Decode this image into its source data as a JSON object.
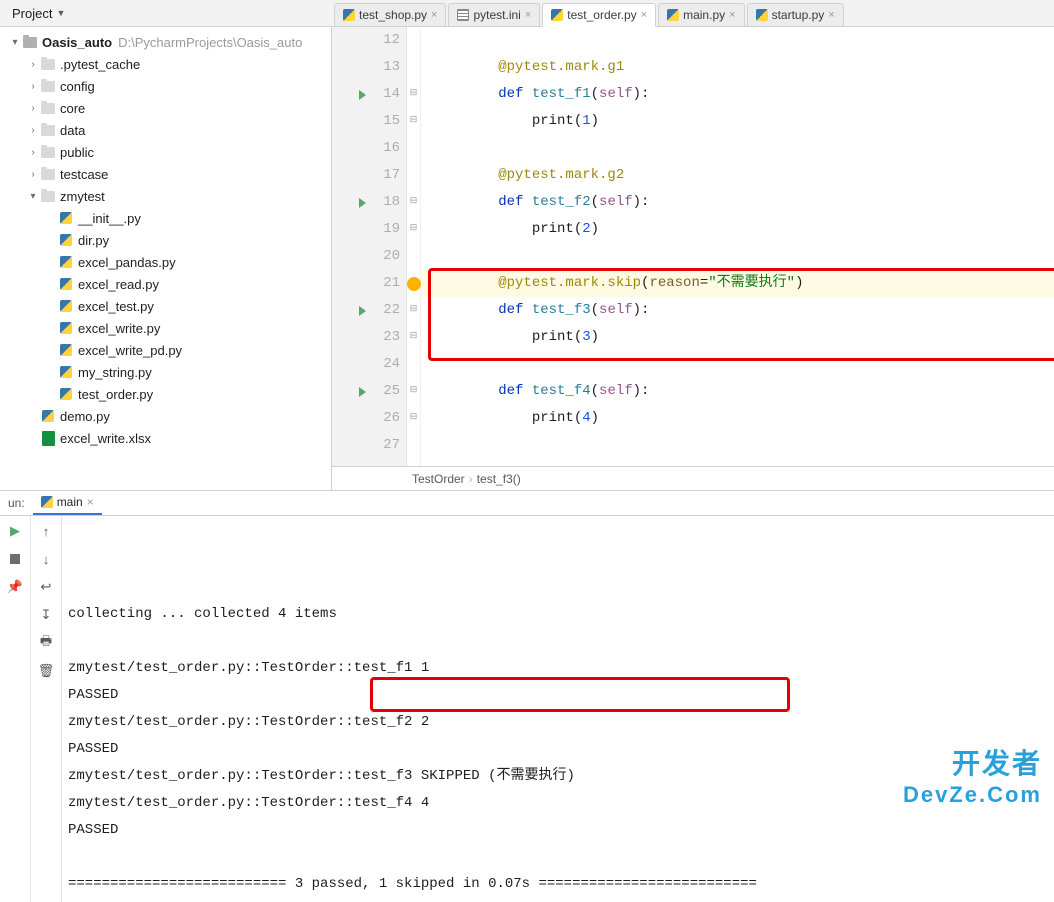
{
  "toolbar": {
    "project_label": "Project"
  },
  "tabs": [
    {
      "label": "test_shop.py",
      "icon": "py",
      "active": false
    },
    {
      "label": "pytest.ini",
      "icon": "cfg",
      "active": false
    },
    {
      "label": "test_order.py",
      "icon": "py",
      "active": true
    },
    {
      "label": "main.py",
      "icon": "py",
      "active": false
    },
    {
      "label": "startup.py",
      "icon": "py",
      "active": false
    }
  ],
  "tree": {
    "root": {
      "name": "Oasis_auto",
      "path": "D:\\PycharmProjects\\Oasis_auto"
    },
    "items": [
      {
        "name": ".pytest_cache",
        "icon": "folder",
        "depth": 1,
        "tw": ">"
      },
      {
        "name": "config",
        "icon": "folder",
        "depth": 1,
        "tw": ">"
      },
      {
        "name": "core",
        "icon": "folder",
        "depth": 1,
        "tw": ">"
      },
      {
        "name": "data",
        "icon": "folder",
        "depth": 1,
        "tw": ">"
      },
      {
        "name": "public",
        "icon": "folder",
        "depth": 1,
        "tw": ">"
      },
      {
        "name": "testcase",
        "icon": "folder",
        "depth": 1,
        "tw": ">"
      },
      {
        "name": "zmytest",
        "icon": "folder",
        "depth": 1,
        "tw": "v"
      },
      {
        "name": "__init__.py",
        "icon": "py",
        "depth": 2
      },
      {
        "name": "dir.py",
        "icon": "py",
        "depth": 2
      },
      {
        "name": "excel_pandas.py",
        "icon": "py",
        "depth": 2
      },
      {
        "name": "excel_read.py",
        "icon": "py",
        "depth": 2
      },
      {
        "name": "excel_test.py",
        "icon": "py",
        "depth": 2
      },
      {
        "name": "excel_write.py",
        "icon": "py",
        "depth": 2
      },
      {
        "name": "excel_write_pd.py",
        "icon": "py",
        "depth": 2
      },
      {
        "name": "my_string.py",
        "icon": "py",
        "depth": 2
      },
      {
        "name": "test_order.py",
        "icon": "py",
        "depth": 2
      },
      {
        "name": "demo.py",
        "icon": "py",
        "depth": 1
      },
      {
        "name": "excel_write.xlsx",
        "icon": "xlsx",
        "depth": 1
      }
    ]
  },
  "editor": {
    "lines": [
      {
        "n": 12,
        "parts": []
      },
      {
        "n": 13,
        "parts": [
          {
            "t": "@pytest.mark.g1",
            "c": "dec"
          }
        ]
      },
      {
        "n": 14,
        "run": true,
        "parts": [
          {
            "t": "def ",
            "c": "kw"
          },
          {
            "t": "test_f1",
            "c": "fn"
          },
          {
            "t": "("
          },
          {
            "t": "self",
            "c": "bself"
          },
          {
            "t": "):"
          }
        ]
      },
      {
        "n": 15,
        "parts": [
          {
            "t": "    print",
            "c": ""
          },
          {
            "t": "("
          },
          {
            "t": "1",
            "c": "num"
          },
          {
            "t": ")"
          }
        ]
      },
      {
        "n": 16,
        "parts": []
      },
      {
        "n": 17,
        "parts": [
          {
            "t": "@pytest.mark.g2",
            "c": "dec"
          }
        ]
      },
      {
        "n": 18,
        "run": true,
        "parts": [
          {
            "t": "def ",
            "c": "kw"
          },
          {
            "t": "test_f2",
            "c": "fn"
          },
          {
            "t": "("
          },
          {
            "t": "self",
            "c": "bself"
          },
          {
            "t": "):"
          }
        ]
      },
      {
        "n": 19,
        "parts": [
          {
            "t": "    print",
            "c": ""
          },
          {
            "t": "("
          },
          {
            "t": "2",
            "c": "num"
          },
          {
            "t": ")"
          }
        ]
      },
      {
        "n": 20,
        "parts": []
      },
      {
        "n": 21,
        "hl": true,
        "bulb": true,
        "parts": [
          {
            "t": "@pytest.mark.skip",
            "c": "dec"
          },
          {
            "t": "("
          },
          {
            "t": "reason",
            "c": "param"
          },
          {
            "t": "="
          },
          {
            "t": "\"不需要执行\"",
            "c": "str"
          },
          {
            "t": ")"
          }
        ]
      },
      {
        "n": 22,
        "run": true,
        "parts": [
          {
            "t": "def ",
            "c": "kw"
          },
          {
            "t": "test_f3",
            "c": "fn"
          },
          {
            "t": "("
          },
          {
            "t": "self",
            "c": "bself"
          },
          {
            "t": "):"
          }
        ]
      },
      {
        "n": 23,
        "parts": [
          {
            "t": "    print",
            "c": ""
          },
          {
            "t": "("
          },
          {
            "t": "3",
            "c": "num"
          },
          {
            "t": ")"
          }
        ]
      },
      {
        "n": 24,
        "parts": []
      },
      {
        "n": 25,
        "run": true,
        "parts": [
          {
            "t": "def ",
            "c": "kw"
          },
          {
            "t": "test_f4",
            "c": "fn"
          },
          {
            "t": "("
          },
          {
            "t": "self",
            "c": "bself"
          },
          {
            "t": "):"
          }
        ]
      },
      {
        "n": 26,
        "parts": [
          {
            "t": "    print",
            "c": ""
          },
          {
            "t": "("
          },
          {
            "t": "4",
            "c": "num"
          },
          {
            "t": ")"
          }
        ]
      },
      {
        "n": 27,
        "parts": []
      }
    ],
    "breadcrumb": [
      "TestOrder",
      "test_f3()"
    ]
  },
  "run": {
    "label": "un:",
    "tab": "main",
    "lines": [
      "collecting ... collected 4 items",
      "",
      "zmytest/test_order.py::TestOrder::test_f1 1",
      "PASSED",
      "zmytest/test_order.py::TestOrder::test_f2 2",
      "PASSED",
      "zmytest/test_order.py::TestOrder::test_f3 SKIPPED (不需要执行)",
      "zmytest/test_order.py::TestOrder::test_f4 4",
      "PASSED",
      "",
      "========================== 3 passed, 1 skipped in 0.07s =========================="
    ]
  },
  "watermark": {
    "l1": "开发者",
    "l2": "DevZe.Com"
  }
}
